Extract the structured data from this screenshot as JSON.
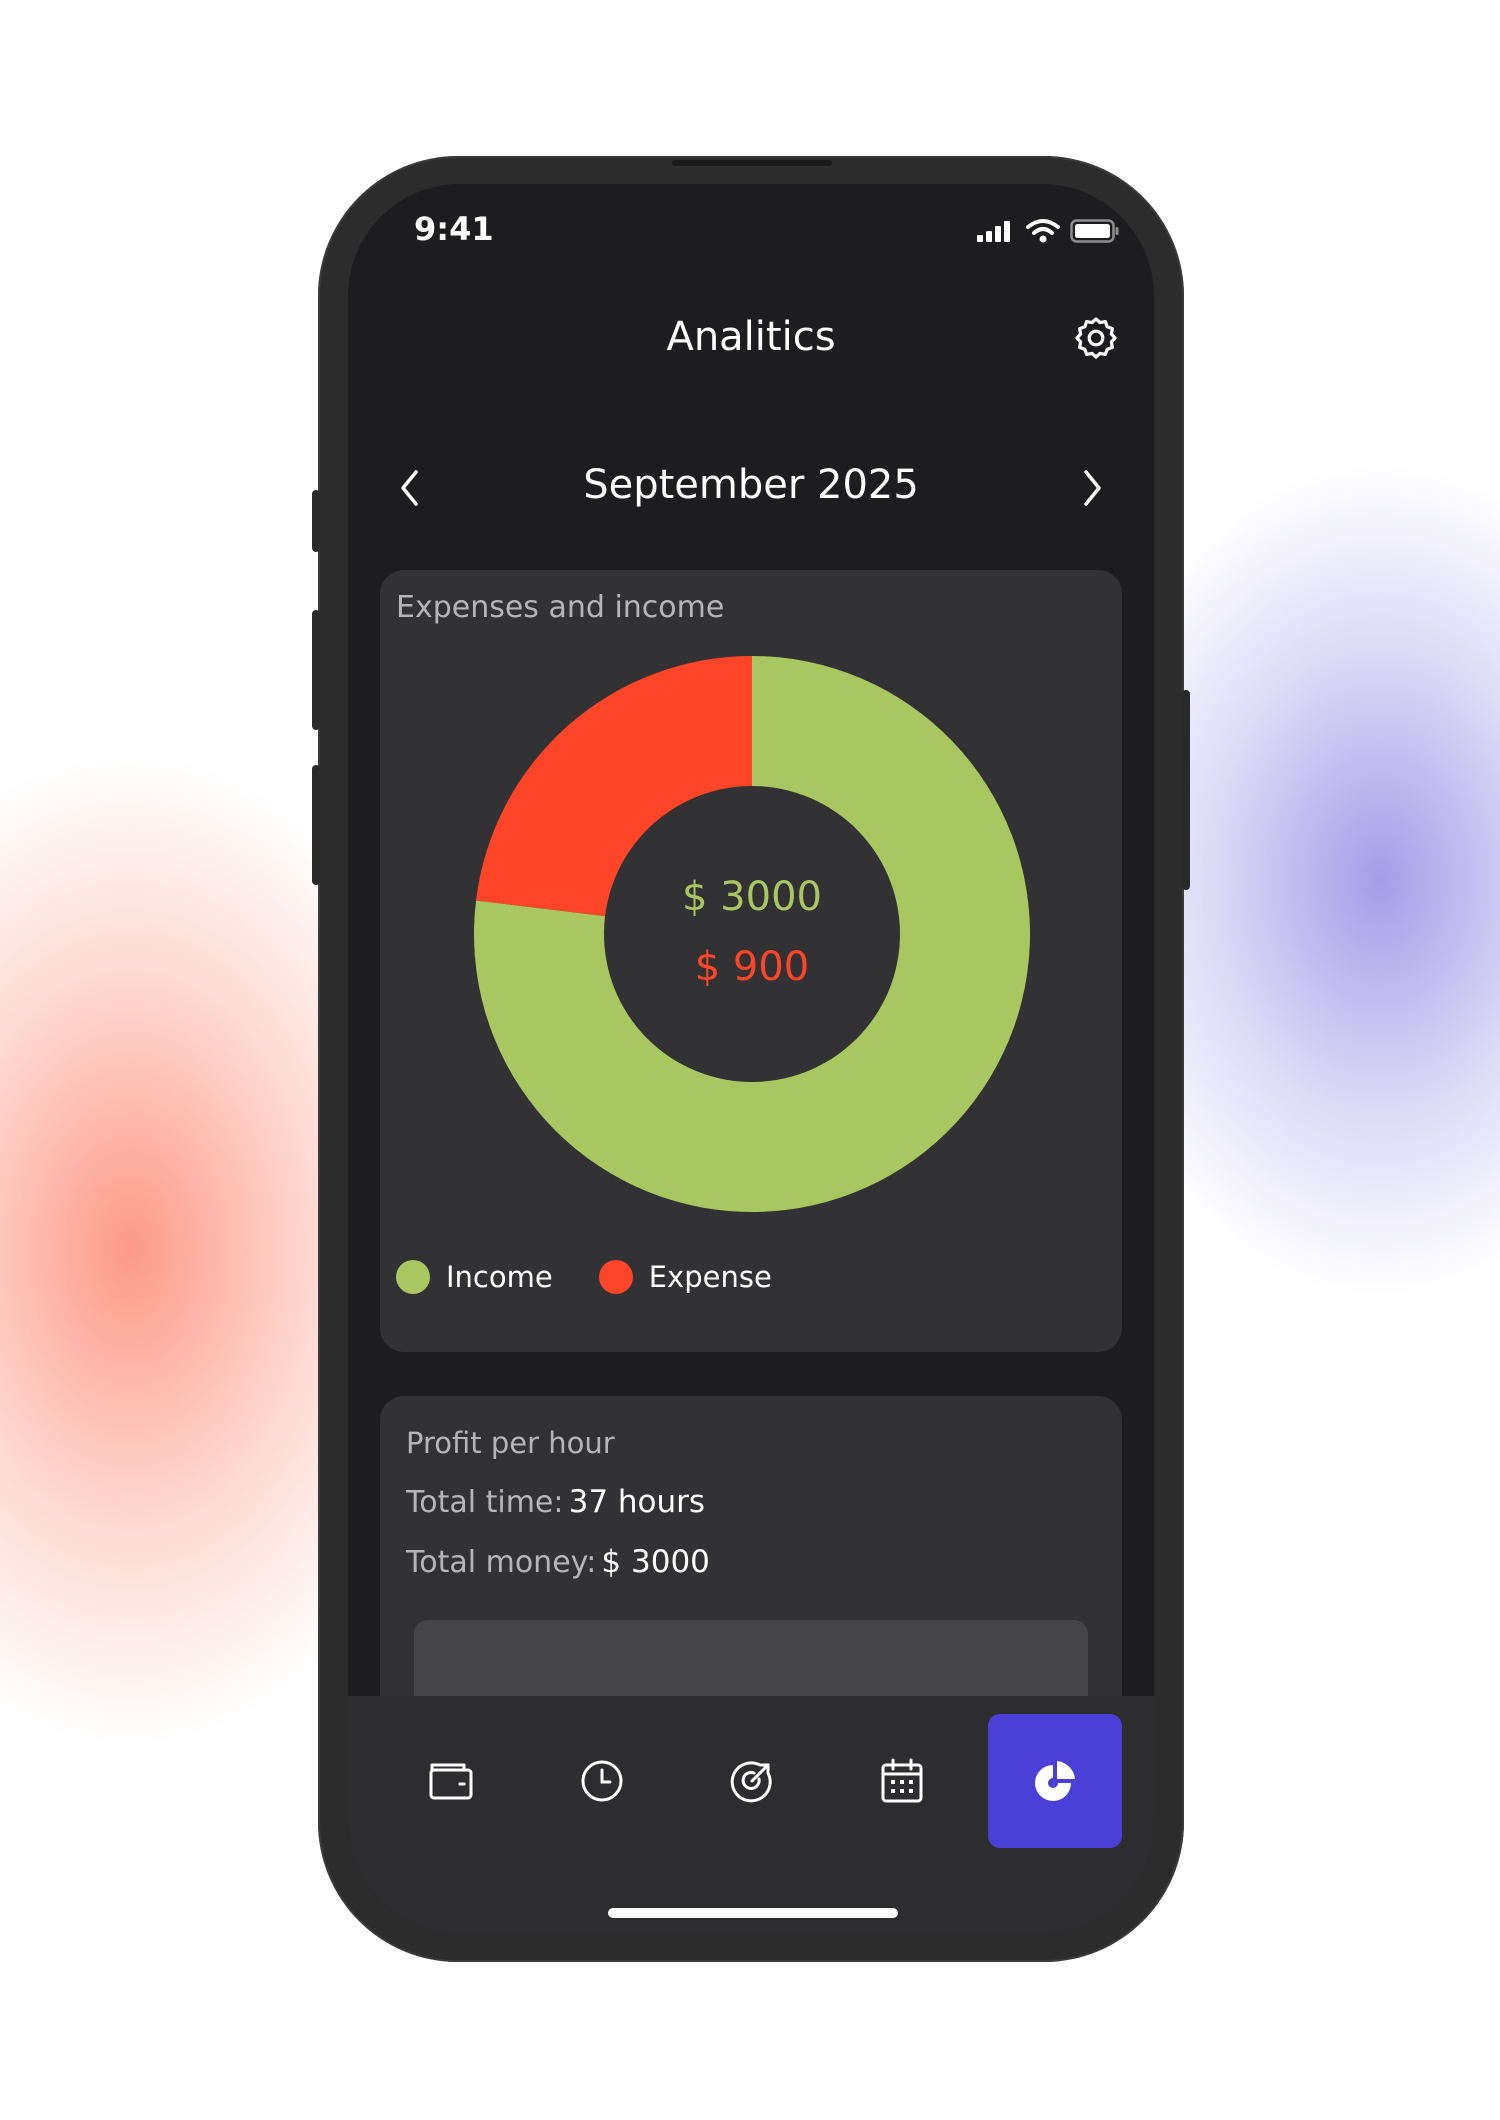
{
  "status_bar": {
    "time": "9:41"
  },
  "header": {
    "title": "Analitics"
  },
  "month_nav": {
    "label": "September 2025"
  },
  "expenses_card": {
    "title": "Expenses and income",
    "income_text": "$ 3000",
    "expense_text": "$ 900"
  },
  "chart_data": {
    "type": "pie",
    "title": "Expenses and income",
    "slices": [
      {
        "name": "Income",
        "value": 3000,
        "color": "#a8c760"
      },
      {
        "name": "Expense",
        "value": 900,
        "color": "#ff4528"
      }
    ],
    "legend_position": "bottom-left"
  },
  "legend": {
    "income_label": "Income",
    "expense_label": "Expense"
  },
  "profit_card": {
    "title": "Profit per hour",
    "time_label": "Total time:",
    "time_value": "37 hours",
    "money_label": "Total money:",
    "money_value": "$ 3000"
  },
  "bottom_nav": {
    "items": [
      {
        "icon": "wallet-icon",
        "active": false
      },
      {
        "icon": "clock-icon",
        "active": false
      },
      {
        "icon": "target-icon",
        "active": false
      },
      {
        "icon": "calendar-icon",
        "active": false
      },
      {
        "icon": "pie-chart-icon",
        "active": true
      }
    ]
  },
  "colors": {
    "income": "#a8c760",
    "expense": "#ff4528",
    "accent": "#4a3fd6",
    "card_bg": "#323234",
    "screen_bg": "#1d1d1f"
  }
}
